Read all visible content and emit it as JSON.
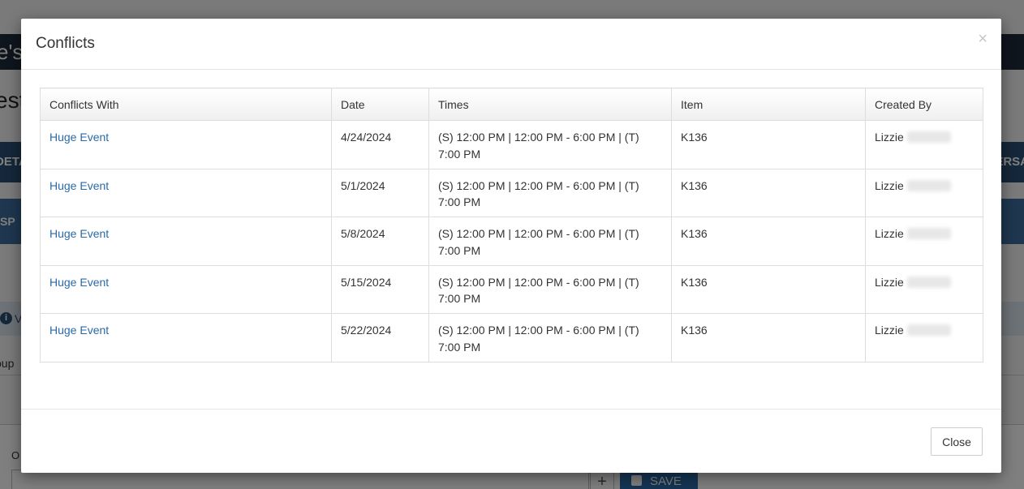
{
  "background": {
    "topbar_text": "e's",
    "heading_text": "est",
    "navbar_left": "DETA",
    "navbar_right": "ERSA",
    "tabbar_left": "SP",
    "info_icon": "info-icon",
    "info_text": "V",
    "group_label": "oup",
    "panel_label": "O",
    "plus_label": "+",
    "save_label": "SAVE"
  },
  "modal": {
    "title": "Conflicts",
    "close_glyph": "×",
    "close_button": "Close",
    "columns": [
      "Conflicts With",
      "Date",
      "Times",
      "Item",
      "Created By"
    ],
    "rows": [
      {
        "conflicts_with": "Huge Event",
        "date": "4/24/2024",
        "times": "(S) 12:00 PM | 12:00 PM - 6:00 PM | (T) 7:00 PM",
        "item": "K136",
        "created_by": "Lizzie"
      },
      {
        "conflicts_with": "Huge Event",
        "date": "5/1/2024",
        "times": "(S) 12:00 PM | 12:00 PM - 6:00 PM | (T) 7:00 PM",
        "item": "K136",
        "created_by": "Lizzie"
      },
      {
        "conflicts_with": "Huge Event",
        "date": "5/8/2024",
        "times": "(S) 12:00 PM | 12:00 PM - 6:00 PM | (T) 7:00 PM",
        "item": "K136",
        "created_by": "Lizzie"
      },
      {
        "conflicts_with": "Huge Event",
        "date": "5/15/2024",
        "times": "(S) 12:00 PM | 12:00 PM - 6:00 PM | (T) 7:00 PM",
        "item": "K136",
        "created_by": "Lizzie"
      },
      {
        "conflicts_with": "Huge Event",
        "date": "5/22/2024",
        "times": "(S) 12:00 PM | 12:00 PM - 6:00 PM | (T) 7:00 PM",
        "item": "K136",
        "created_by": "Lizzie"
      }
    ]
  },
  "colors": {
    "link": "#2a6aa8",
    "overlay": "rgba(0,0,0,0.5)",
    "navbar": "#2a4f74",
    "tabbar": "#3d6f9e",
    "save_button": "#2a6aa8"
  }
}
